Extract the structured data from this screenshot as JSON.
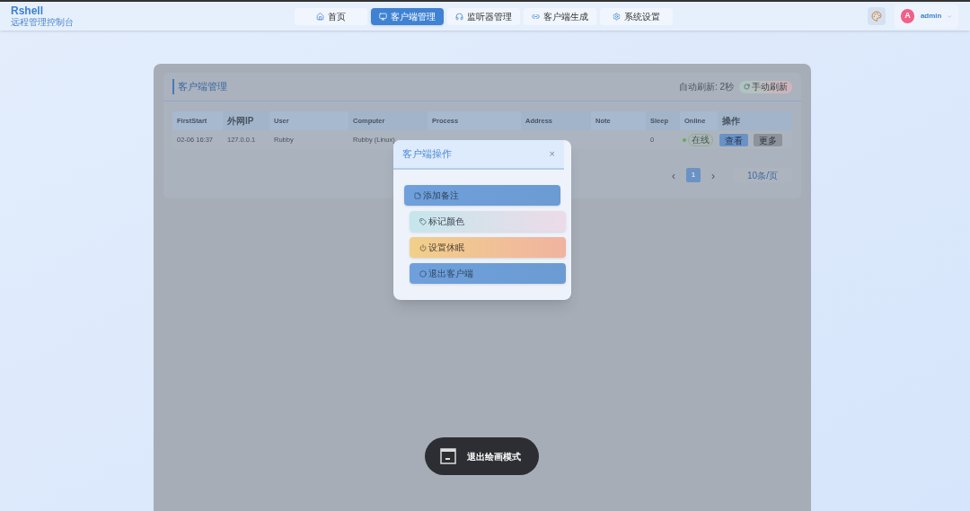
{
  "brand": {
    "title": "Rshell",
    "subtitle": "远程管理控制台"
  },
  "nav": [
    {
      "label": "首页",
      "selected": false
    },
    {
      "label": "客户端管理",
      "selected": true
    },
    {
      "label": "监听器管理",
      "selected": false
    },
    {
      "label": "客户端生成",
      "selected": false
    },
    {
      "label": "系统设置",
      "selected": false
    }
  ],
  "user": {
    "avatar": "A",
    "name": "admin"
  },
  "panel": {
    "title": "客户端管理",
    "auto_refresh": "自动刷新: 2秒",
    "refresh_button": "手动刷新"
  },
  "table": {
    "columns": [
      "FirstStart",
      "外网IP",
      "User",
      "Computer",
      "Process",
      "Address",
      "Note",
      "Sleep",
      "Online",
      "操作"
    ],
    "rows": [
      {
        "first_start": "02-06 16:37",
        "ip": "127.0.0.1",
        "user": "Rubby",
        "computer": "Rubby (Linux)",
        "sleep": "0",
        "online": true,
        "online_label": "在线",
        "actions": [
          "查看",
          "更多"
        ]
      }
    ]
  },
  "pagination": {
    "prev": "‹",
    "pages": [
      {
        "label": "1",
        "selected": true
      }
    ],
    "next": "›",
    "page_size": "10条/页"
  },
  "dialog": {
    "title": "客户端操作",
    "close": "×",
    "actions": [
      {
        "label": "添加备注"
      },
      {
        "label": "标记颜色"
      },
      {
        "label": "设置休眠"
      },
      {
        "label": "退出客户端"
      }
    ]
  },
  "toast": {
    "label": "退出绘画模式"
  }
}
